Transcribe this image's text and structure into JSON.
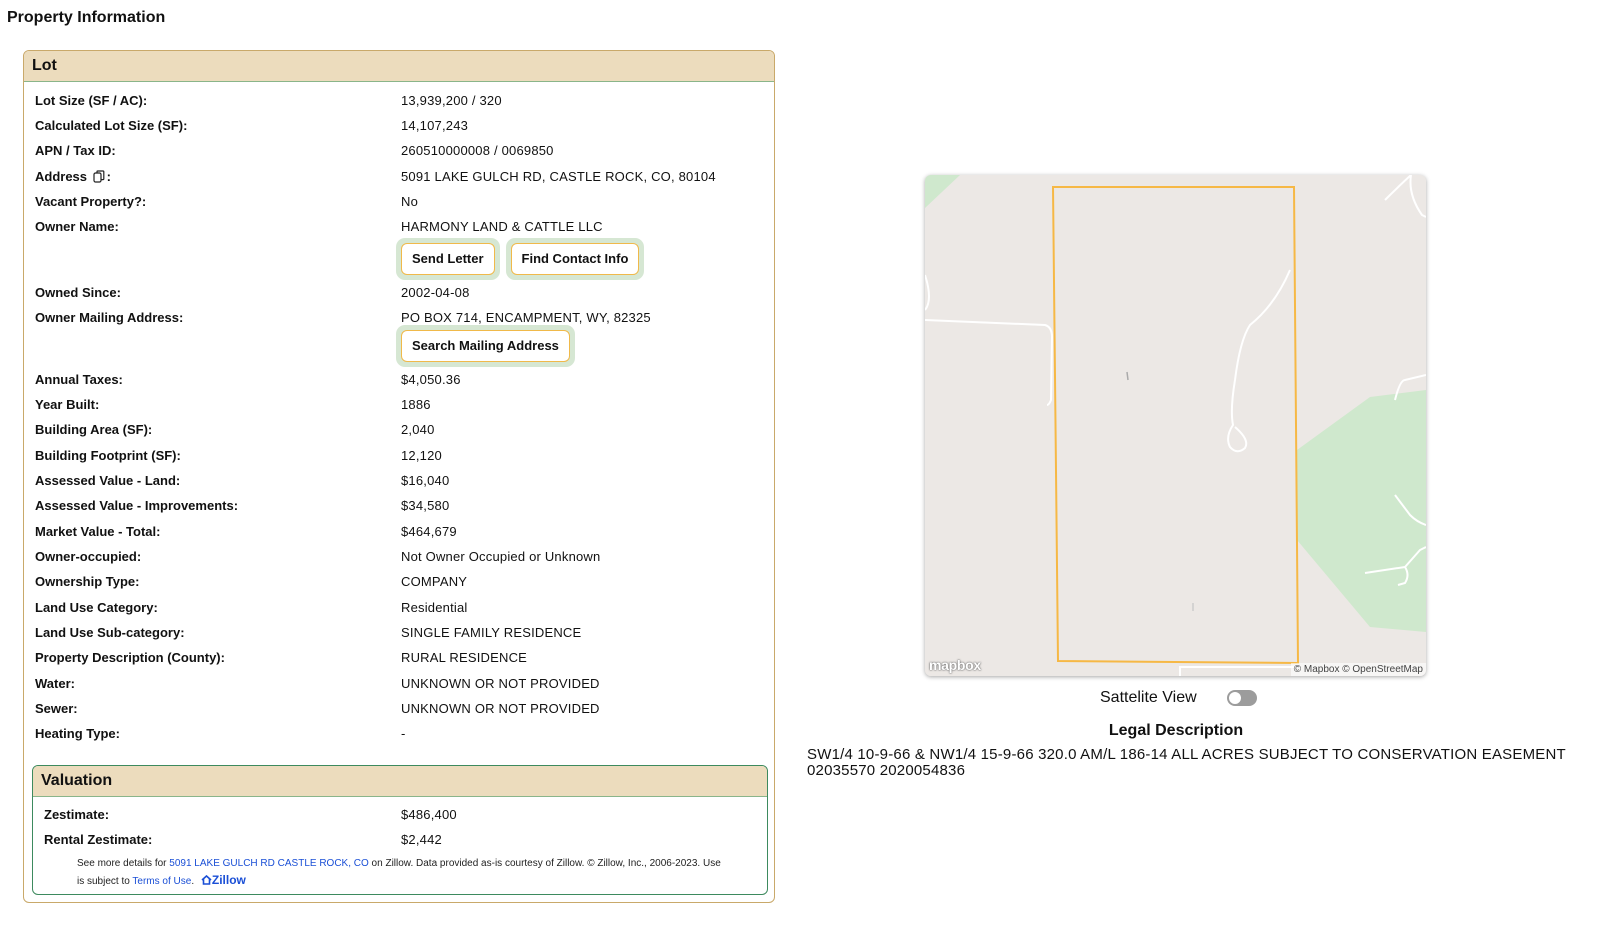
{
  "page": {
    "title": "Property Information"
  },
  "lot": {
    "header": "Lot",
    "rows": [
      {
        "label": "Lot Size (SF / AC):",
        "value": "13,939,200 / 320"
      },
      {
        "label": "Calculated Lot Size (SF):",
        "value": "14,107,243"
      },
      {
        "label": "APN / Tax ID:",
        "value": "260510000008 / 0069850"
      },
      {
        "label": "Address",
        "label_suffix": ":",
        "value": "5091 LAKE GULCH RD, CASTLE ROCK, CO, 80104"
      },
      {
        "label": "Vacant Property?:",
        "value": "No"
      },
      {
        "label": "Owner Name:",
        "value": "HARMONY LAND & CATTLE LLC"
      },
      {
        "label": "Owned Since:",
        "value": "2002-04-08"
      },
      {
        "label": "Owner Mailing Address:",
        "value": "PO BOX 714, ENCAMPMENT, WY, 82325"
      },
      {
        "label": "Annual Taxes:",
        "value": "$4,050.36"
      },
      {
        "label": "Year Built:",
        "value": "1886"
      },
      {
        "label": "Building Area (SF):",
        "value": "2,040"
      },
      {
        "label": "Building Footprint (SF):",
        "value": "12,120"
      },
      {
        "label": "Assessed Value - Land:",
        "value": "$16,040"
      },
      {
        "label": "Assessed Value - Improvements:",
        "value": "$34,580"
      },
      {
        "label": "Market Value - Total:",
        "value": "$464,679"
      },
      {
        "label": "Owner-occupied:",
        "value": "Not Owner Occupied or Unknown"
      },
      {
        "label": "Ownership Type:",
        "value": "COMPANY"
      },
      {
        "label": "Land Use Category:",
        "value": "Residential"
      },
      {
        "label": "Land Use Sub-category:",
        "value": "SINGLE FAMILY RESIDENCE"
      },
      {
        "label": "Property Description (County):",
        "value": "RURAL RESIDENCE"
      },
      {
        "label": "Water:",
        "value": "UNKNOWN OR NOT PROVIDED"
      },
      {
        "label": "Sewer:",
        "value": "UNKNOWN OR NOT PROVIDED"
      },
      {
        "label": "Heating Type:",
        "value": "-"
      }
    ],
    "buttons": {
      "send_letter": "Send Letter",
      "find_contact": "Find Contact Info",
      "search_mailing": "Search Mailing Address"
    }
  },
  "valuation": {
    "header": "Valuation",
    "rows": [
      {
        "label": "Zestimate:",
        "value": "$486,400"
      },
      {
        "label": "Rental Zestimate:",
        "value": "$2,442"
      }
    ],
    "note": {
      "prefix": "See more details for ",
      "link": "5091 LAKE GULCH RD CASTLE ROCK, CO",
      "middle": " on Zillow. Data provided as-is courtesy of Zillow. © Zillow, Inc., 2006-2023. Use is subject to ",
      "terms": "Terms of Use",
      "suffix": ".",
      "logo": "Zillow"
    }
  },
  "map": {
    "logo": "mapbox",
    "attribution": "© Mapbox © OpenStreetMap",
    "parcel_color": "#f6b845",
    "land_color": "#ece8e5",
    "park_color": "#cfe8cd"
  },
  "satellite": {
    "label": "Sattelite View",
    "enabled": false
  },
  "legal": {
    "title": "Legal Description",
    "text": "SW1/4 10-9-66 & NW1/4 15-9-66 320.0 AM/L 186-14 ALL ACRES SUBJECT TO CONSERVATION EASEMENT 02035570 2020054836"
  },
  "icons": {
    "copy": "copy-icon",
    "zillow": "zillow-logo-icon",
    "mapbox": "mapbox-logo-icon"
  }
}
